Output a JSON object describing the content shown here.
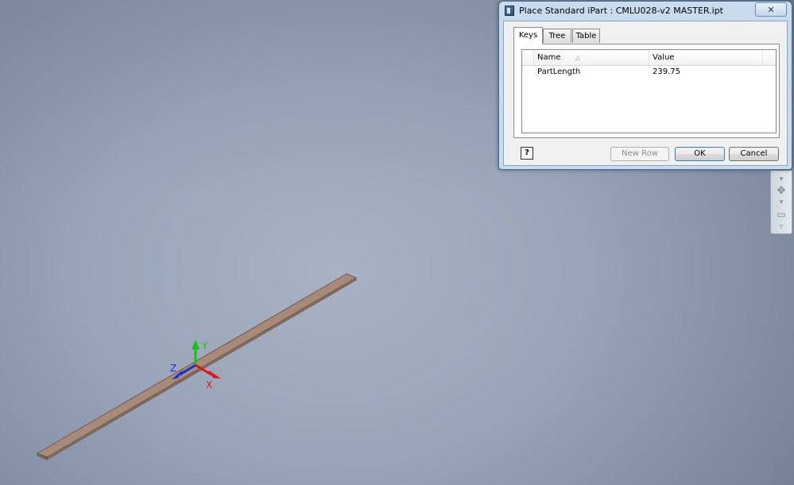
{
  "dialog": {
    "title": "Place Standard iPart : CMLU028-v2 MASTER.ipt",
    "close_label": "✕",
    "tabs": [
      {
        "label": "Keys",
        "active": true
      },
      {
        "label": "Tree",
        "active": false
      },
      {
        "label": "Table",
        "active": false
      }
    ],
    "list": {
      "columns": [
        "Name",
        "Value"
      ],
      "sort_icon": "△",
      "rows": [
        {
          "name": "PartLength",
          "value": "239.75"
        }
      ]
    },
    "buttons": {
      "help": "?",
      "new_row": "New Row",
      "ok": "OK",
      "cancel": "Cancel"
    }
  },
  "viewport": {
    "axis_labels": {
      "x": "X",
      "y": "Y",
      "z": "Z"
    },
    "part_color": "#a88a7a",
    "axis_colors": {
      "x": "#e01515",
      "y": "#17c217",
      "z": "#1530d8"
    }
  },
  "navbar": {
    "glyphs": [
      "▾",
      "✥",
      "▾",
      "▭",
      "▿"
    ]
  }
}
